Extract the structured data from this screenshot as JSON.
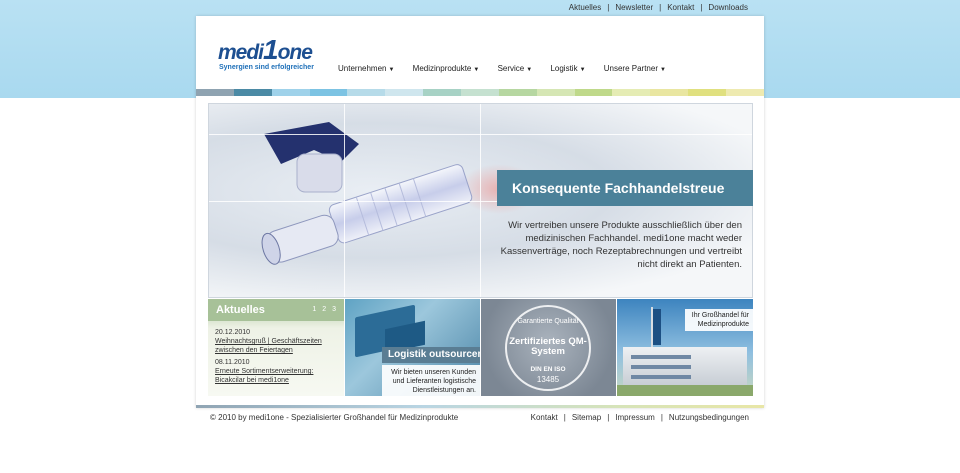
{
  "top_nav": [
    {
      "label": "Aktuelles"
    },
    {
      "label": "Newsletter"
    },
    {
      "label": "Kontakt"
    },
    {
      "label": "Downloads"
    }
  ],
  "brand": {
    "name_left": "medi",
    "name_mid": "1",
    "name_right": "one",
    "tagline": "Synergien sind erfolgreicher",
    "color": "#1d4f91"
  },
  "main_nav": [
    {
      "label": "Unternehmen"
    },
    {
      "label": "Medizinprodukte"
    },
    {
      "label": "Service"
    },
    {
      "label": "Logistik"
    },
    {
      "label": "Unsere Partner"
    }
  ],
  "color_stripes": [
    "#8fa3b1",
    "#4b8aa5",
    "#9fd2ea",
    "#7cc3e3",
    "#b6dbe9",
    "#cfe6ee",
    "#a7d2c5",
    "#c5e1d0",
    "#b6d7a1",
    "#d5e6b4",
    "#bfd98a",
    "#e5ecb4",
    "#e9e6a1",
    "#e0e07f",
    "#eeeab0"
  ],
  "hero": {
    "title": "Konsequente Fachhandelstreue",
    "text": "Wir vertreiben unsere Produkte ausschließlich über den medizinischen Fachhandel. medi1one macht weder Kassenverträge, noch Rezeptabrechnungen und vertreibt nicht direkt an Patienten."
  },
  "news": {
    "title": "Aktuelles",
    "pages": [
      "1",
      "2",
      "3"
    ],
    "items": [
      {
        "date": "20.12.2010",
        "link": "Weihnachtsgruß | Geschäftszeiten zwischen den Feiertagen"
      },
      {
        "date": "08.11.2010",
        "link": "Erneute Sortimentserweiterung: Bicakcilar bei medi1one"
      }
    ]
  },
  "logistics_tile": {
    "title": "Logistik outsourcen",
    "text": "Wir bieten unseren Kunden und Lieferanten logistische Dienstleistungen an."
  },
  "quality_tile": {
    "line1": "Garantierte Qualität",
    "line2": "Zertifiziertes QM-System",
    "line3": "DIN EN ISO",
    "line4": "13485"
  },
  "wholesale_tile": {
    "text": "Ihr Großhandel für Medizinprodukte"
  },
  "footer": {
    "copyright": "© 2010 by medi1one - Spezialisierter Großhandel für Medizinprodukte",
    "links": [
      {
        "label": "Kontakt"
      },
      {
        "label": "Sitemap"
      },
      {
        "label": "Impressum"
      },
      {
        "label": "Nutzungsbedingungen"
      }
    ]
  }
}
